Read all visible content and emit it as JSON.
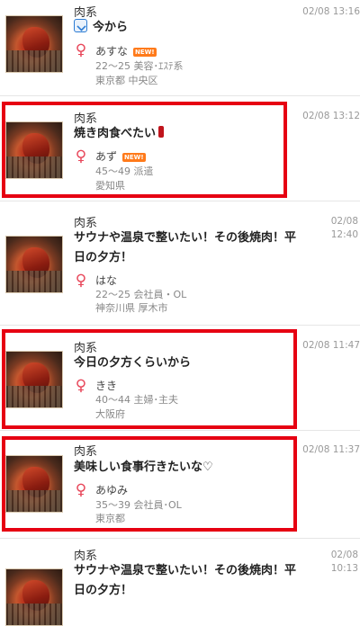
{
  "posts": [
    {
      "category": "肉系",
      "title": "今から",
      "time": "02/08 13:16",
      "name": "あすな",
      "new_badge": "NEW!",
      "age_job": "22～25 美容･ｴｽﾃ系",
      "location": "東京都 中央区"
    },
    {
      "category": "肉系",
      "title": "焼き肉食べたい",
      "time": "02/08 13:12",
      "name": "あず",
      "new_badge": "NEW!",
      "age_job": "45～49 派遣",
      "location": "愛知県"
    },
    {
      "category": "肉系",
      "title": "サウナや温泉で整いたい！その後焼肉！平日の夕方！",
      "time_date": "02/08",
      "time_clock": "12:40",
      "name": "はな",
      "age_job": "22～25 会社員・OL",
      "location": "神奈川県 厚木市"
    },
    {
      "category": "肉系",
      "title": "今日の夕方くらいから",
      "time": "02/08 11:47",
      "name": "きき",
      "age_job": "40～44 主婦･主夫",
      "location": "大阪府"
    },
    {
      "category": "肉系",
      "title": "美味しい食事行きたいな♡",
      "time": "02/08 11:37",
      "name": "あゆみ",
      "age_job": "35～39 会社員･OL",
      "location": "東京都"
    },
    {
      "category": "肉系",
      "title": "サウナや温泉で整いたい！その後焼肉！平日の夕方！",
      "time_date": "02/08",
      "time_clock": "10:13"
    }
  ],
  "gender_symbol": "♀",
  "colors": {
    "highlight": "#e60012",
    "female": "#e8475a",
    "new_badge": "#ff7a1a"
  },
  "icons": [
    "square-check-icon",
    "mobile-phone-icon",
    "female-icon"
  ]
}
